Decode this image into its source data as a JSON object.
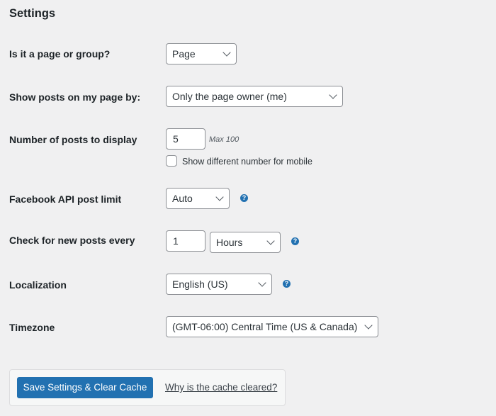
{
  "title": "Settings",
  "fields": {
    "type": {
      "label": "Is it a page or group?",
      "value": "Page"
    },
    "show_posts_by": {
      "label": "Show posts on my page by:",
      "value": "Only the page owner (me)"
    },
    "num_posts": {
      "label": "Number of posts to display",
      "value": "5",
      "hint": "Max 100",
      "mobile_checkbox_label": "Show different number for mobile",
      "mobile_checked": false
    },
    "api_limit": {
      "label": "Facebook API post limit",
      "value": "Auto",
      "help_icon": "?"
    },
    "check_interval": {
      "label": "Check for new posts every",
      "value": "1",
      "unit": "Hours",
      "help_icon": "?"
    },
    "localization": {
      "label": "Localization",
      "value": "English (US)",
      "help_icon": "?"
    },
    "timezone": {
      "label": "Timezone",
      "value": "(GMT-06:00) Central Time (US & Canada)"
    }
  },
  "footer": {
    "save_label": "Save Settings & Clear Cache",
    "why_link": "Why is the cache cleared?"
  },
  "colors": {
    "accent": "#2271b1",
    "background": "#f0f0f1"
  }
}
